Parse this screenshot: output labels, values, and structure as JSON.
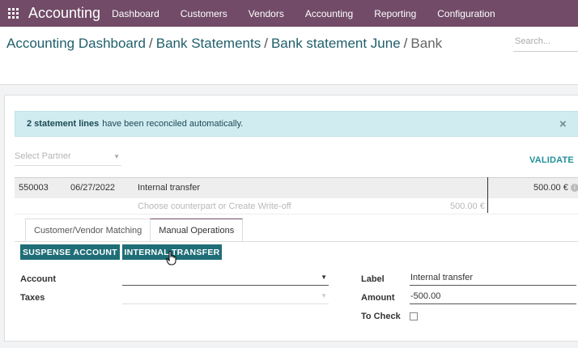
{
  "navbar": {
    "app_name": "Accounting",
    "menu": [
      "Dashboard",
      "Customers",
      "Vendors",
      "Accounting",
      "Reporting",
      "Configuration"
    ]
  },
  "breadcrumb": {
    "items": [
      "Accounting Dashboard",
      "Bank Statements",
      "Bank statement June"
    ],
    "current": "Bank"
  },
  "search": {
    "placeholder": "Search..."
  },
  "alert": {
    "bold": "2 statement lines",
    "text": "have been reconciled automatically.",
    "close_icon": "×"
  },
  "partner": {
    "placeholder": "Select Partner"
  },
  "validate_label": "VALIDATE",
  "statement_line": {
    "ref": "550003",
    "date": "06/27/2022",
    "label": "Internal transfer",
    "amount": "500.00 €"
  },
  "counterpart": {
    "placeholder": "Choose counterpart or Create Write-off",
    "amount": "500.00 €"
  },
  "tabs": [
    "Customer/Vendor Matching",
    "Manual Operations"
  ],
  "buttons": {
    "suspense": "SUSPENSE ACCOUNT",
    "internal_transfer": "INTERNAL TRANSFER"
  },
  "form": {
    "account_label": "Account",
    "account_value": "",
    "taxes_label": "Taxes",
    "taxes_value": "",
    "label_label": "Label",
    "label_value": "Internal transfer",
    "amount_label": "Amount",
    "amount_value": "-500.00",
    "to_check_label": "To Check",
    "to_check_checked": false
  },
  "colors": {
    "navbar": "#714b67",
    "accent": "#21909b",
    "button": "#1f6e77",
    "alert_bg": "#d1ecf1"
  }
}
